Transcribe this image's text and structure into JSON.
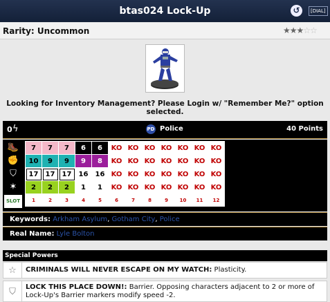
{
  "window": {
    "title": "btas024 Lock-Up",
    "back_icon": "back-arrow-icon",
    "dial_label": "[DIAL]"
  },
  "rarity": {
    "label": "Rarity: Uncommon",
    "stars_filled": "★★★",
    "stars_empty": "☆☆",
    "rating": 3,
    "max": 5
  },
  "login_message": {
    "line1": "Looking for Inventory Management? Please Login w/ \"Remember Me?\" option",
    "line2": "selected."
  },
  "header": {
    "point_cost": "0",
    "team_abbr": "PD",
    "team_name": "Police",
    "points": "40 Points"
  },
  "dial": {
    "stat_icons": [
      "speed-icon",
      "attack-icon",
      "defense-icon",
      "damage-icon"
    ],
    "slot_label": "SLOT",
    "slots": [
      "1",
      "2",
      "3",
      "4",
      "5",
      "6",
      "7",
      "8",
      "9",
      "10",
      "11",
      "12"
    ],
    "rows": [
      {
        "name": "speed",
        "cells": [
          {
            "v": "7",
            "c": "pink"
          },
          {
            "v": "7",
            "c": "pink"
          },
          {
            "v": "7",
            "c": "pink"
          },
          {
            "v": "6",
            "c": "black"
          },
          {
            "v": "6",
            "c": "black"
          },
          {
            "v": "KO",
            "c": "ko"
          },
          {
            "v": "KO",
            "c": "ko"
          },
          {
            "v": "KO",
            "c": "ko"
          },
          {
            "v": "KO",
            "c": "ko"
          },
          {
            "v": "KO",
            "c": "ko"
          },
          {
            "v": "KO",
            "c": "ko"
          },
          {
            "v": "KO",
            "c": "ko"
          }
        ]
      },
      {
        "name": "attack",
        "cells": [
          {
            "v": "10",
            "c": "teal"
          },
          {
            "v": "9",
            "c": "teal"
          },
          {
            "v": "9",
            "c": "teal"
          },
          {
            "v": "9",
            "c": "purple"
          },
          {
            "v": "8",
            "c": "purple"
          },
          {
            "v": "KO",
            "c": "ko"
          },
          {
            "v": "KO",
            "c": "ko"
          },
          {
            "v": "KO",
            "c": "ko"
          },
          {
            "v": "KO",
            "c": "ko"
          },
          {
            "v": "KO",
            "c": "ko"
          },
          {
            "v": "KO",
            "c": "ko"
          },
          {
            "v": "KO",
            "c": "ko"
          }
        ]
      },
      {
        "name": "defense",
        "cells": [
          {
            "v": "17",
            "c": "wbox"
          },
          {
            "v": "17",
            "c": "wbox"
          },
          {
            "v": "17",
            "c": "wbox"
          },
          {
            "v": "16",
            "c": "plain"
          },
          {
            "v": "16",
            "c": "plain"
          },
          {
            "v": "KO",
            "c": "ko"
          },
          {
            "v": "KO",
            "c": "ko"
          },
          {
            "v": "KO",
            "c": "ko"
          },
          {
            "v": "KO",
            "c": "ko"
          },
          {
            "v": "KO",
            "c": "ko"
          },
          {
            "v": "KO",
            "c": "ko"
          },
          {
            "v": "KO",
            "c": "ko"
          }
        ]
      },
      {
        "name": "damage",
        "cells": [
          {
            "v": "2",
            "c": "green"
          },
          {
            "v": "2",
            "c": "green"
          },
          {
            "v": "2",
            "c": "green"
          },
          {
            "v": "1",
            "c": "plain"
          },
          {
            "v": "1",
            "c": "plain"
          },
          {
            "v": "KO",
            "c": "ko"
          },
          {
            "v": "KO",
            "c": "ko"
          },
          {
            "v": "KO",
            "c": "ko"
          },
          {
            "v": "KO",
            "c": "ko"
          },
          {
            "v": "KO",
            "c": "ko"
          },
          {
            "v": "KO",
            "c": "ko"
          },
          {
            "v": "KO",
            "c": "ko"
          }
        ]
      }
    ]
  },
  "keywords": {
    "label": "Keywords:",
    "items": [
      "Arkham Asylum",
      "Gotham City",
      "Police"
    ]
  },
  "real_name": {
    "label": "Real Name:",
    "value": "Lyle Bolton"
  },
  "special_powers": {
    "header": "Special Powers",
    "powers": [
      {
        "icon": "star-outline-icon",
        "name": "CRIMINALS WILL NEVER ESCAPE ON MY WATCH:",
        "text": " Plasticity."
      },
      {
        "icon": "shield-icon",
        "name": "LOCK THIS PLACE DOWN!:",
        "text": " Barrier. Opposing characters adjacent to 2 or more of Lock-Up's Barrier markers modify speed -2."
      }
    ]
  },
  "colors": {
    "pink": "#f4b8c8",
    "teal": "#1fb2b2",
    "purple": "#9b1e9b",
    "green": "#98d21f",
    "ko": "#c00000",
    "title_bg": "#1b2a46"
  }
}
